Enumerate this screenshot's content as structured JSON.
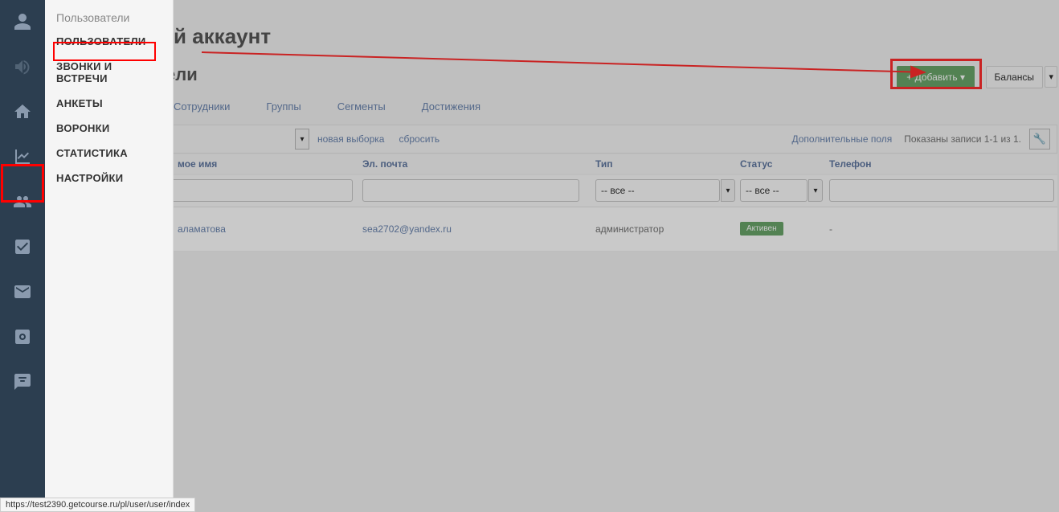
{
  "submenu": {
    "title": "Пользователи",
    "items": [
      "ПОЛЬЗОВАТЕЛИ",
      "ЗВОНКИ И ВСТРЕЧИ",
      "АНКЕТЫ",
      "ВОРОНКИ",
      "СТАТИСТИКА",
      "НАСТРОЙКИ"
    ]
  },
  "page": {
    "title_suffix": "й аккаунт",
    "subtitle_suffix": "ели"
  },
  "buttons": {
    "add": "+ Добавить ▾",
    "balances": "Балансы",
    "balances_caret": "▾"
  },
  "tabs": [
    "Сотрудники",
    "Группы",
    "Сегменты",
    "Достижения"
  ],
  "filter_bar": {
    "new_selection": "новая выборка",
    "reset": "сбросить",
    "extra_fields": "Дополнительные поля",
    "records": "Показаны записи 1-1 из 1.",
    "caret": "▾"
  },
  "columns": {
    "name": "мое имя",
    "email": "Эл. почта",
    "type": "Тип",
    "status": "Статус",
    "phone": "Телефон"
  },
  "filters": {
    "all_option": "-- все --"
  },
  "row": {
    "name": "аламатова",
    "email": "sea2702@yandex.ru",
    "type": "администратор",
    "status": "Активен",
    "phone": "-"
  },
  "status_url": "https://test2390.getcourse.ru/pl/user/user/index"
}
